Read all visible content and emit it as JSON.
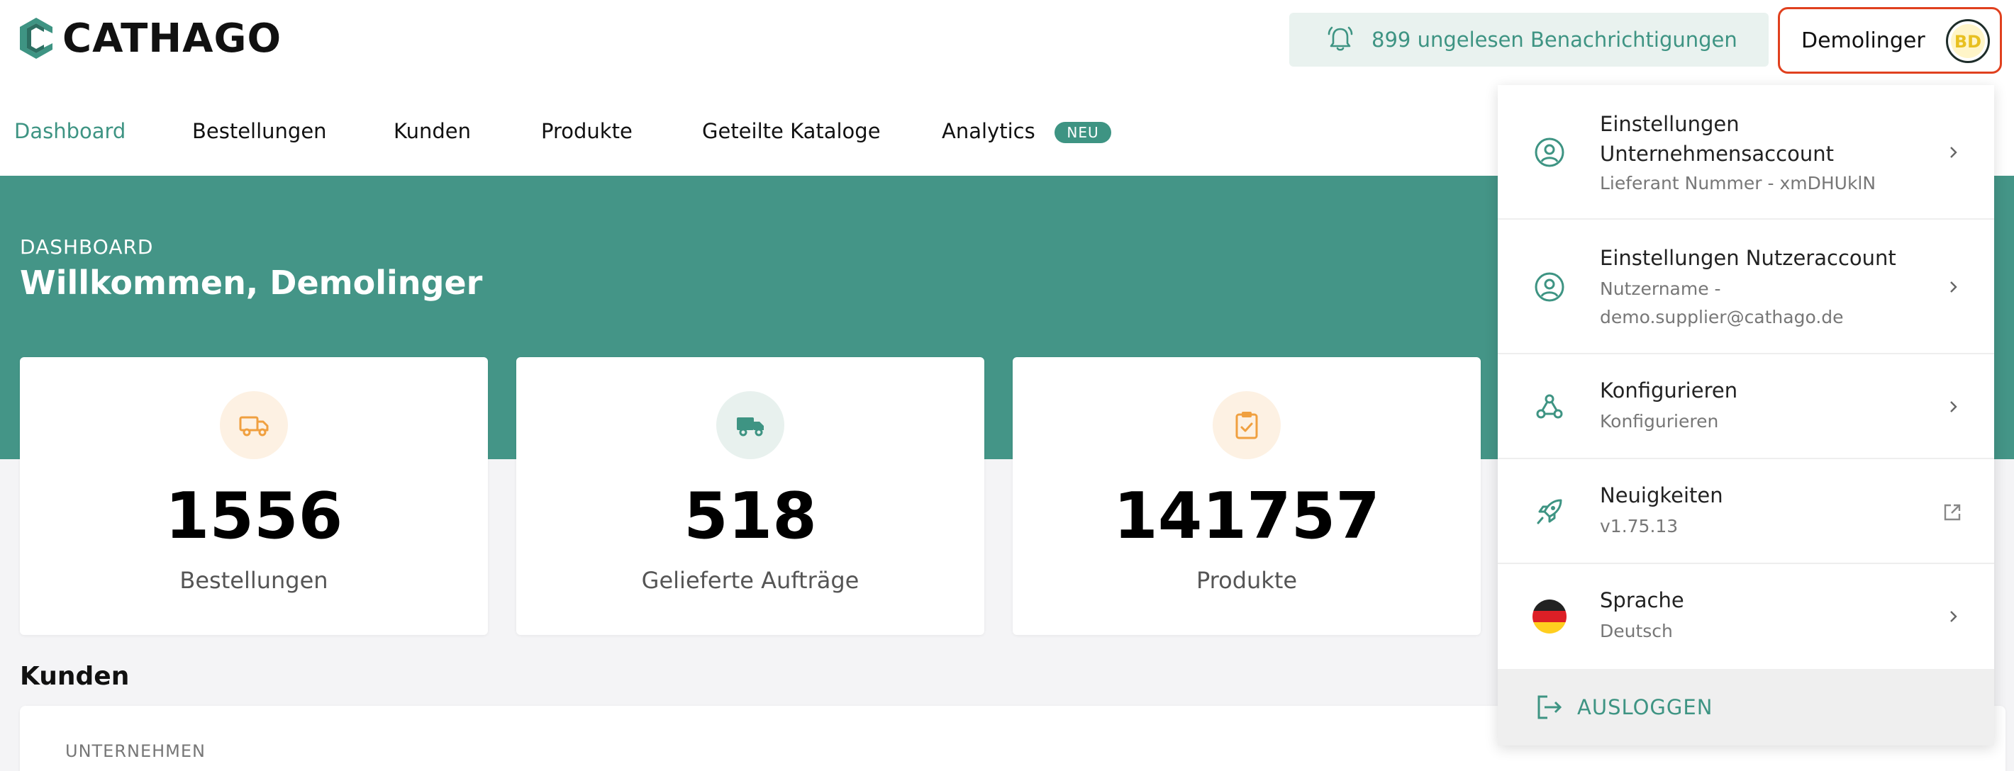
{
  "header": {
    "brand": "CATHAGO",
    "notifications_label": "899 ungelesen Benachrichtigungen",
    "user_name": "Demolinger",
    "avatar_initials": "BD"
  },
  "nav": {
    "items": [
      {
        "label": "Dashboard",
        "active": true
      },
      {
        "label": "Bestellungen"
      },
      {
        "label": "Kunden"
      },
      {
        "label": "Produkte"
      },
      {
        "label": "Geteilte Kataloge"
      },
      {
        "label": "Analytics",
        "badge": "NEU"
      }
    ]
  },
  "hero": {
    "kicker": "DASHBOARD",
    "title": "Willkommen, Demolinger"
  },
  "stats": [
    {
      "value": "1556",
      "label": "Bestellungen",
      "icon": "truck-icon",
      "icon_color": "#f0a040",
      "icon_bg": "#fdf1e3"
    },
    {
      "value": "518",
      "label": "Gelieferte Aufträge",
      "icon": "delivery-truck-icon",
      "icon_color": "#3e9483",
      "icon_bg": "#e8f1ee"
    },
    {
      "value": "141757",
      "label": "Produkte",
      "icon": "clipboard-check-icon",
      "icon_color": "#f0a040",
      "icon_bg": "#fdf1e3"
    }
  ],
  "customers": {
    "title": "Kunden",
    "column_header": "UNTERNEHMEN"
  },
  "dropdown": {
    "items": [
      {
        "title": "Einstellungen Unternehmensaccount",
        "subtitle": "Lieferant Nummer - xmDHUklN",
        "icon": "user-circle-icon",
        "action": "chevron"
      },
      {
        "title": "Einstellungen Nutzeraccount",
        "subtitle": "Nutzername - demo.supplier@cathago.de",
        "icon": "user-circle-icon",
        "action": "chevron"
      },
      {
        "title": "Konfigurieren",
        "subtitle": "Konfigurieren",
        "icon": "webhook-icon",
        "action": "chevron"
      },
      {
        "title": "Neuigkeiten",
        "subtitle": "v1.75.13",
        "icon": "rocket-icon",
        "action": "external"
      },
      {
        "title": "Sprache",
        "subtitle": "Deutsch",
        "icon": "german-flag-icon",
        "action": "chevron"
      }
    ],
    "logout_label": "AUSLOGGEN"
  },
  "colors": {
    "brand": "#3e9483",
    "hero": "#449587",
    "highlight_border": "#e0401e"
  }
}
